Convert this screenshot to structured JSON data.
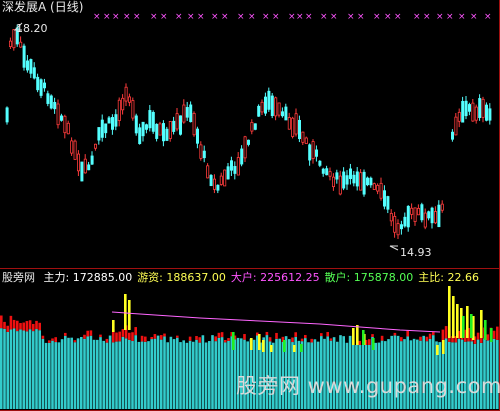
{
  "title": "深发展A (日线)",
  "price_panel": {
    "high_label": "18.20",
    "low_label": "14.93",
    "signal_marker": "×"
  },
  "indicator_bar": {
    "name": "股旁网",
    "items": [
      {
        "label": "主力:",
        "value": "172885.00",
        "color": "#ffffff"
      },
      {
        "label": "游资:",
        "value": "188637.00",
        "color": "#ffff55"
      },
      {
        "label": "大户:",
        "value": "225612.25",
        "color": "#ff55ff"
      },
      {
        "label": "散户:",
        "value": "175878.00",
        "color": "#55ff55"
      },
      {
        "label": "主比:",
        "value": "22.66",
        "color": "#ffff55"
      }
    ]
  },
  "watermark": "股旁网 www.gupang.com",
  "colors": {
    "background": "#000000",
    "up": "#ff3c3c",
    "down": "#54ffff",
    "border": "#a01010",
    "marker": "#ff55ff",
    "bar_cyan": "#33cccc",
    "bar_red": "#ee1111",
    "bar_green": "#22ee22",
    "bar_yellow": "#ffff22",
    "line_magenta": "#ff66ff"
  }
}
